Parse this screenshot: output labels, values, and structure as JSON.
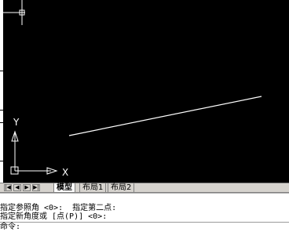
{
  "ucs": {
    "y_label": "Y",
    "x_label": "X"
  },
  "tabs": {
    "nav": [
      "|◀",
      "◀",
      "▶",
      "▶|"
    ],
    "items": [
      {
        "label": "模型",
        "active": true
      },
      {
        "label": "布局1",
        "active": false
      },
      {
        "label": "布局2",
        "active": false
      }
    ]
  },
  "command": {
    "history": [
      "指定参照角 <0>:  指定第二点:",
      "指定新角度或 [点(P)] <0>:"
    ],
    "prompt": "命令:",
    "input_value": ""
  },
  "colors": {
    "canvas": "#000000",
    "ui_gray": "#d6d3ce",
    "line": "#ffffff"
  },
  "icons": {
    "crosshair": "crosshair-cursor-icon",
    "ucs": "ucs-icon"
  }
}
